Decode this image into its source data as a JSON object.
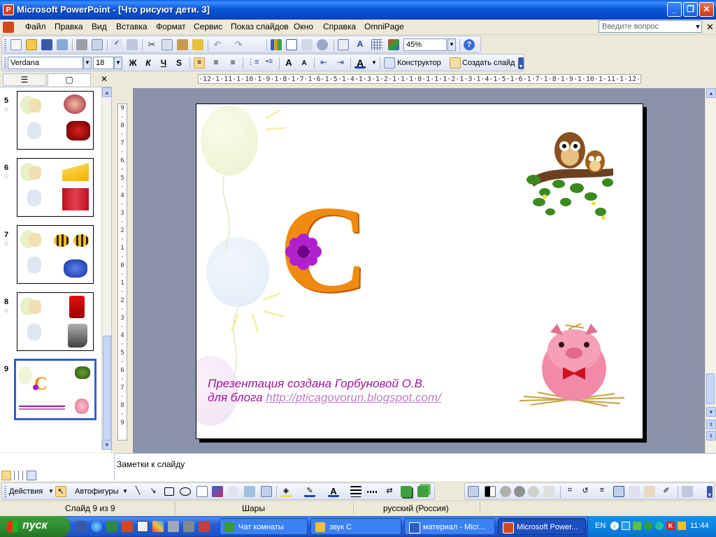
{
  "window": {
    "title": "Microsoft PowerPoint - [Что рисуют дети. 3]",
    "minimize": "_",
    "restore": "❐",
    "close": "✕"
  },
  "menu": {
    "items": [
      "Файл",
      "Правка",
      "Вид",
      "Вставка",
      "Формат",
      "Сервис",
      "Показ слайдов",
      "Окно",
      "Справка",
      "OmniPage"
    ],
    "help_placeholder": "Введите вопрос",
    "close": "✕"
  },
  "toolbar_standard": {
    "zoom": "45%"
  },
  "toolbar_formatting": {
    "font": "Verdana",
    "font_size": "18",
    "bold": "Ж",
    "italic": "К",
    "underline": "Ч",
    "shadow": "S",
    "designer": "Конструктор",
    "new_slide": "Создать слайд"
  },
  "left_pane": {
    "tabs": [
      "☰",
      "▢"
    ],
    "close": "✕",
    "slides": [
      {
        "num": "5"
      },
      {
        "num": "6"
      },
      {
        "num": "7"
      },
      {
        "num": "8"
      },
      {
        "num": "9",
        "selected": true
      }
    ]
  },
  "ruler": {
    "horizontal": "·12·1·11·1·10·1·9·1·8·1·7·1·6·1·5·1·4·1·3·1·2·1·1·1·0·1·1·1·2·1·3·1·4·1·5·1·6·1·7·1·8·1·9·1·10·1·11·1·12·",
    "vertical": [
      "9",
      "·",
      "8",
      "·",
      "7",
      "·",
      "6",
      "·",
      "5",
      "·",
      "4",
      "·",
      "3",
      "·",
      "2",
      "·",
      "1",
      "·",
      "0",
      "·",
      "1",
      "·",
      "2",
      "·",
      "3",
      "·",
      "4",
      "·",
      "5",
      "·",
      "6",
      "·",
      "7",
      "·",
      "8",
      "·",
      "9"
    ]
  },
  "slide": {
    "letter": "С",
    "caption_line1": "Презентация создана Горбуновой О.В.",
    "caption_line2_prefix": "для блога ",
    "caption_link": "http://pticagovorun.blogspot.com/",
    "colors": {
      "caption": "#a0149c",
      "letter_orange": "#f08a10",
      "flower": "#a020c0"
    }
  },
  "notes": {
    "placeholder": "Заметки к слайду"
  },
  "drawing_toolbar": {
    "actions": "Действия",
    "autoshapes": "Автофигуры"
  },
  "status": {
    "slide": "Слайд 9 из 9",
    "design": "Шары",
    "language": "русский (Россия)"
  },
  "taskbar": {
    "start": "пуск",
    "tasks": [
      {
        "label": "Чат комнаты",
        "active": false,
        "icon_color": "#3a9a3a"
      },
      {
        "label": "звук С",
        "active": false,
        "icon_color": "#f0c040"
      },
      {
        "label": "материал - Micr...",
        "active": false,
        "icon_color": "#2b5fc8"
      },
      {
        "label": "Microsoft Power...",
        "active": true,
        "icon_color": "#d4471c"
      }
    ],
    "lang": "EN",
    "time": "11:44"
  }
}
